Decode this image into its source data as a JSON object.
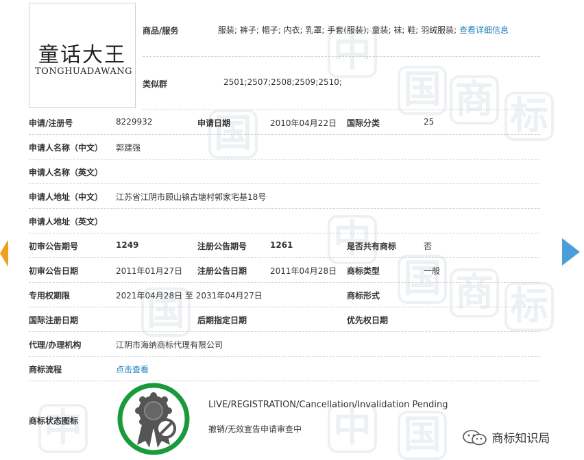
{
  "logo": {
    "cn": "童话大王",
    "en": "TONGHUADAWANG"
  },
  "goods": {
    "label": "商品/服务",
    "value": "服装; 裤子; 帽子; 内衣; 乳罩; 手套(服装); 童装; 袜; 鞋; 羽绒服装;",
    "link": "查看详细信息"
  },
  "similar": {
    "label": "类似群",
    "value": "2501;2507;2508;2509;2510;"
  },
  "rows": {
    "reg_no_label": "申请/注册号",
    "reg_no": "8229932",
    "apply_date_label": "申请日期",
    "apply_date": "2010年04月22日",
    "intl_class_label": "国际分类",
    "intl_class": "25",
    "applicant_cn_label": "申请人名称（中文）",
    "applicant_cn": "郭建强",
    "applicant_en_label": "申请人名称（英文）",
    "address_cn_label": "申请人地址（中文）",
    "address_cn": "江苏省江阴市顾山镇古塘村郭家宅基18号",
    "address_en_label": "申请人地址（英文）",
    "prelim_no_label": "初审公告期号",
    "prelim_no": "1249",
    "reg_pub_no_label": "注册公告期号",
    "reg_pub_no": "1261",
    "shared_label": "是否共有商标",
    "shared": "否",
    "prelim_date_label": "初审公告日期",
    "prelim_date": "2011年01月27日",
    "reg_pub_date_label": "注册公告日期",
    "reg_pub_date": "2011年04月28日",
    "tm_type_label": "商标类型",
    "tm_type": "一般",
    "exclusive_label": "专用权期限",
    "exclusive": "2021年04月28日 至 2031年04月27日",
    "tm_form_label": "商标形式",
    "intl_reg_date_label": "国际注册日期",
    "later_date_label": "后期指定日期",
    "priority_date_label": "优先权日期",
    "agent_label": "代理/办理机构",
    "agent": "江阴市海纳商标代理有限公司",
    "flow_label": "商标流程",
    "flow_link": "点击查看",
    "status_icon_label": "商标状态图标",
    "status_en": "LIVE/REGISTRATION/Cancellation/Invalidation Pending",
    "status_cn": "撤销/无效宣告申请审查中"
  },
  "footer": {
    "wechat_account": "商标知识局"
  },
  "colors": {
    "link": "#1a7fbd",
    "badge_green": "#1a9a3a",
    "arrow_orange": "#f0a020",
    "arrow_blue": "#4a9fd8"
  }
}
